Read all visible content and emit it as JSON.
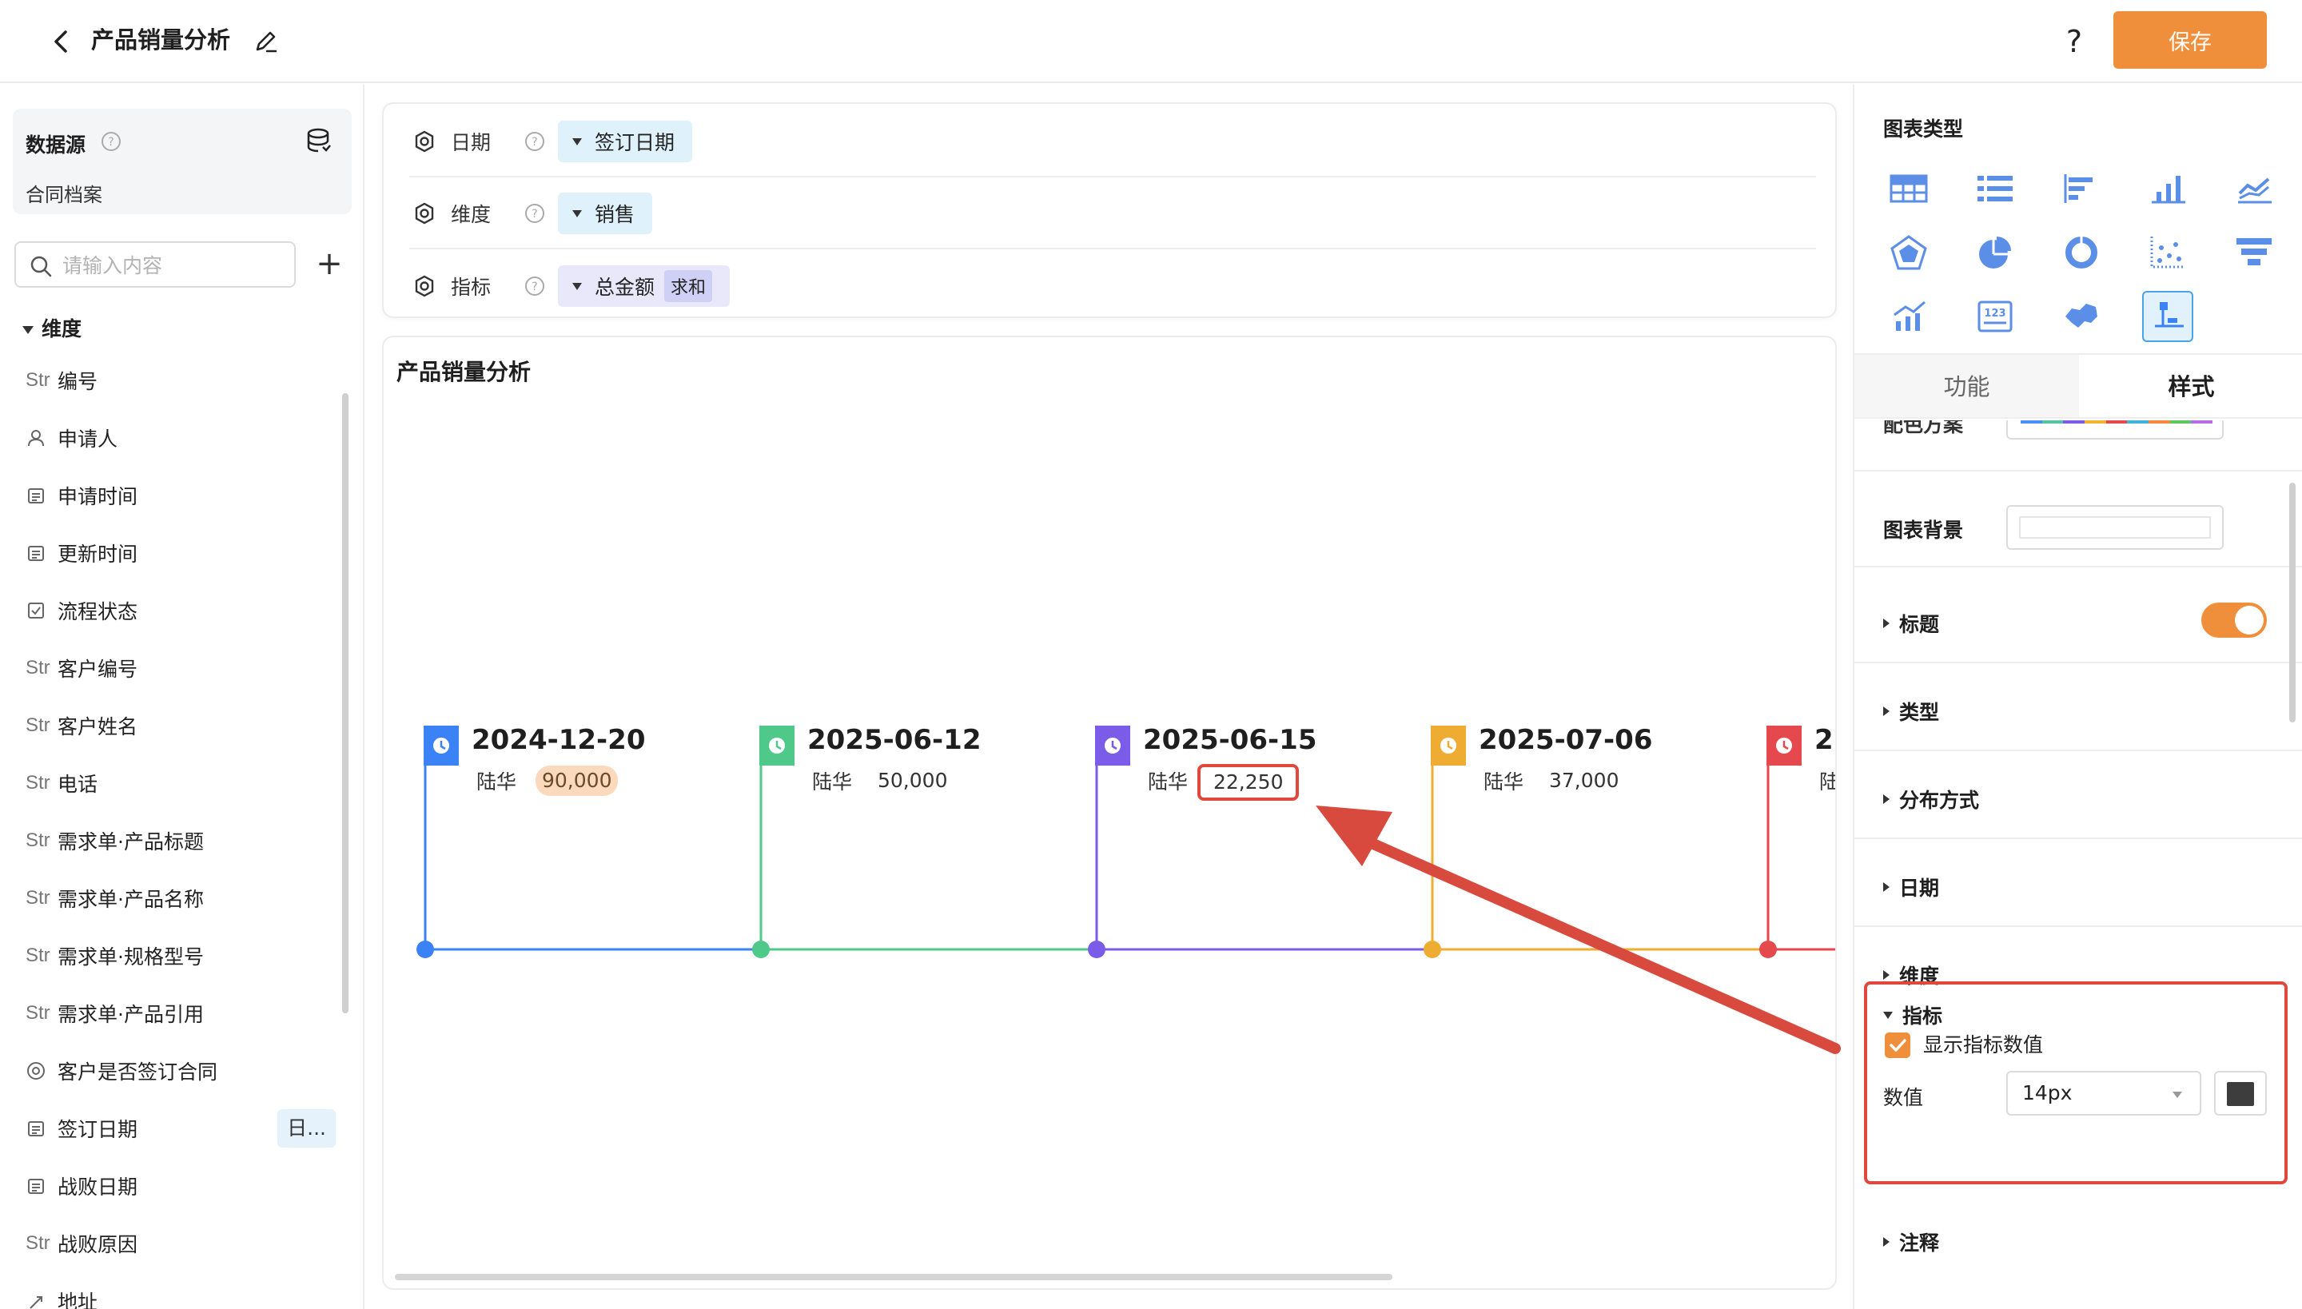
{
  "header": {
    "title": "产品销量分析",
    "help_label": "?",
    "save_label": "保存"
  },
  "datasource": {
    "title": "数据源",
    "name": "合同档案"
  },
  "search": {
    "placeholder": "请输入内容",
    "value": ""
  },
  "fields": {
    "section_label": "维度",
    "items": [
      {
        "type": "Str",
        "label": "编号",
        "icon": "str-type"
      },
      {
        "type": "",
        "label": "申请人",
        "icon": "person-icon"
      },
      {
        "type": "",
        "label": "申请时间",
        "icon": "calendar-icon"
      },
      {
        "type": "",
        "label": "更新时间",
        "icon": "calendar-icon"
      },
      {
        "type": "",
        "label": "流程状态",
        "icon": "checkbox-icon"
      },
      {
        "type": "Str",
        "label": "客户编号",
        "icon": "str-type"
      },
      {
        "type": "Str",
        "label": "客户姓名",
        "icon": "str-type"
      },
      {
        "type": "Str",
        "label": "电话",
        "icon": "str-type"
      },
      {
        "type": "Str",
        "label": "需求单·产品标题",
        "icon": "str-type"
      },
      {
        "type": "Str",
        "label": "需求单·产品名称",
        "icon": "str-type"
      },
      {
        "type": "Str",
        "label": "需求单·规格型号",
        "icon": "str-type"
      },
      {
        "type": "Str",
        "label": "需求单·产品引用",
        "icon": "str-type"
      },
      {
        "type": "",
        "label": "客户是否签订合同",
        "icon": "radio-icon"
      },
      {
        "type": "",
        "label": "签订日期",
        "icon": "calendar-icon",
        "tag": "日..."
      },
      {
        "type": "",
        "label": "战败日期",
        "icon": "calendar-icon"
      },
      {
        "type": "Str",
        "label": "战败原因",
        "icon": "str-type"
      },
      {
        "type": "",
        "label": "地址",
        "icon": "location-icon"
      }
    ]
  },
  "config": {
    "rows": [
      {
        "label": "日期",
        "pill": "签订日期",
        "agg": ""
      },
      {
        "label": "维度",
        "pill": "销售",
        "agg": ""
      },
      {
        "label": "指标",
        "pill": "总金额",
        "agg": "求和"
      }
    ]
  },
  "chart": {
    "title": "产品销量分析"
  },
  "timeline": {
    "entries": [
      {
        "date": "2024-12-20",
        "name": "陆华",
        "value": "90,000",
        "color": "#3b82f6"
      },
      {
        "date": "2025-06-12",
        "name": "陆华",
        "value": "50,000",
        "color": "#4fc98a"
      },
      {
        "date": "2025-06-15",
        "name": "陆华",
        "value": "22,250",
        "color": "#7b5ce8"
      },
      {
        "date": "2025-07-06",
        "name": "陆华",
        "value": "37,000",
        "color": "#efac33"
      },
      {
        "date": "2",
        "name": "陆",
        "value": "",
        "color": "#e5484d"
      }
    ]
  },
  "right_panel": {
    "chart_type_title": "图表类型",
    "tabs": [
      "功能",
      "样式"
    ],
    "color_scheme_label": "配色方案",
    "scheme_colors": [
      "#4e8ef7",
      "#53c5a0",
      "#7b5ce8",
      "#f2b533",
      "#e5484d",
      "#3fb6d8",
      "#f58a3c",
      "#5dc763",
      "#b46ee6"
    ],
    "background_label": "图表背景",
    "sections": [
      "标题",
      "类型",
      "分布方式",
      "日期",
      "维度",
      "指标",
      "注释"
    ],
    "show_value_label": "显示指标数值",
    "value_label": "数值",
    "value_size": "14px"
  }
}
